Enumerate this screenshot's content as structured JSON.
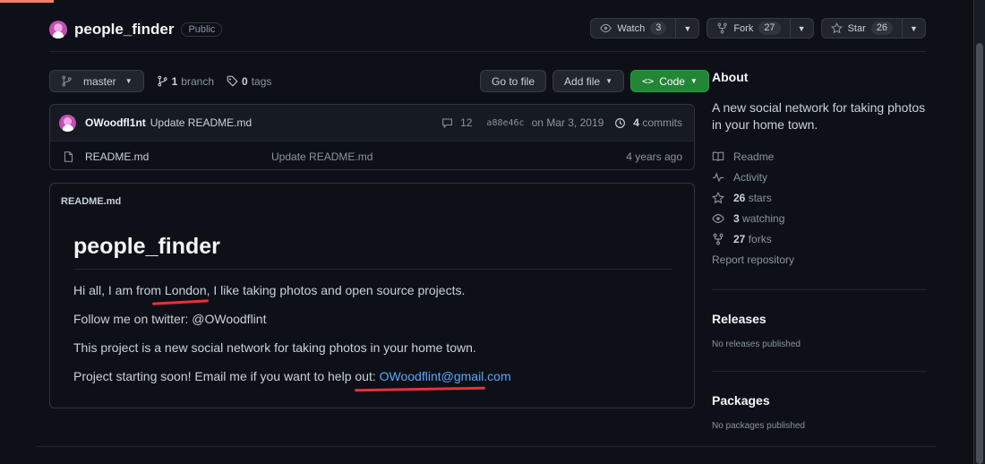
{
  "repo": {
    "name": "people_finder",
    "visibility": "Public"
  },
  "actions": {
    "watch_label": "Watch",
    "watch_count": "3",
    "fork_label": "Fork",
    "fork_count": "27",
    "star_label": "Star",
    "star_count": "26"
  },
  "branch_bar": {
    "branch": "master",
    "branch_count": "1",
    "branch_label": "branch",
    "tag_count": "0",
    "tag_label": "tags",
    "go_to_file": "Go to file",
    "add_file": "Add file",
    "code": "Code"
  },
  "commit": {
    "author": "OWoodfl1nt",
    "message": "Update README.md",
    "comments": "12",
    "sha": "a88e46c",
    "date": "on Mar 3, 2019",
    "commit_count": "4",
    "commit_label": "commits"
  },
  "files": [
    {
      "name": "README.md",
      "commit": "Update README.md",
      "age": "4 years ago"
    }
  ],
  "readme": {
    "label": "README.md",
    "title": "people_finder",
    "p1": "Hi all, I am from London, I like taking photos and open source projects.",
    "p2": "Follow me on twitter: @OWoodflint",
    "p3": "This project is a new social network for taking photos in your home town.",
    "p4_text": "Project starting soon! Email me if you want to help out: ",
    "p4_link": "OWoodflint@gmail.com"
  },
  "about": {
    "title": "About",
    "description": "A new social network for taking photos in your home town.",
    "readme": "Readme",
    "activity": "Activity",
    "stars_count": "26",
    "stars_label": "stars",
    "watching_count": "3",
    "watching_label": "watching",
    "forks_count": "27",
    "forks_label": "forks",
    "report": "Report repository"
  },
  "releases": {
    "title": "Releases",
    "empty": "No releases published"
  },
  "packages": {
    "title": "Packages",
    "empty": "No packages published"
  },
  "colors": {
    "accent_green": "#238636",
    "link_blue": "#58a6ff",
    "annotation_red": "#e5323b"
  }
}
